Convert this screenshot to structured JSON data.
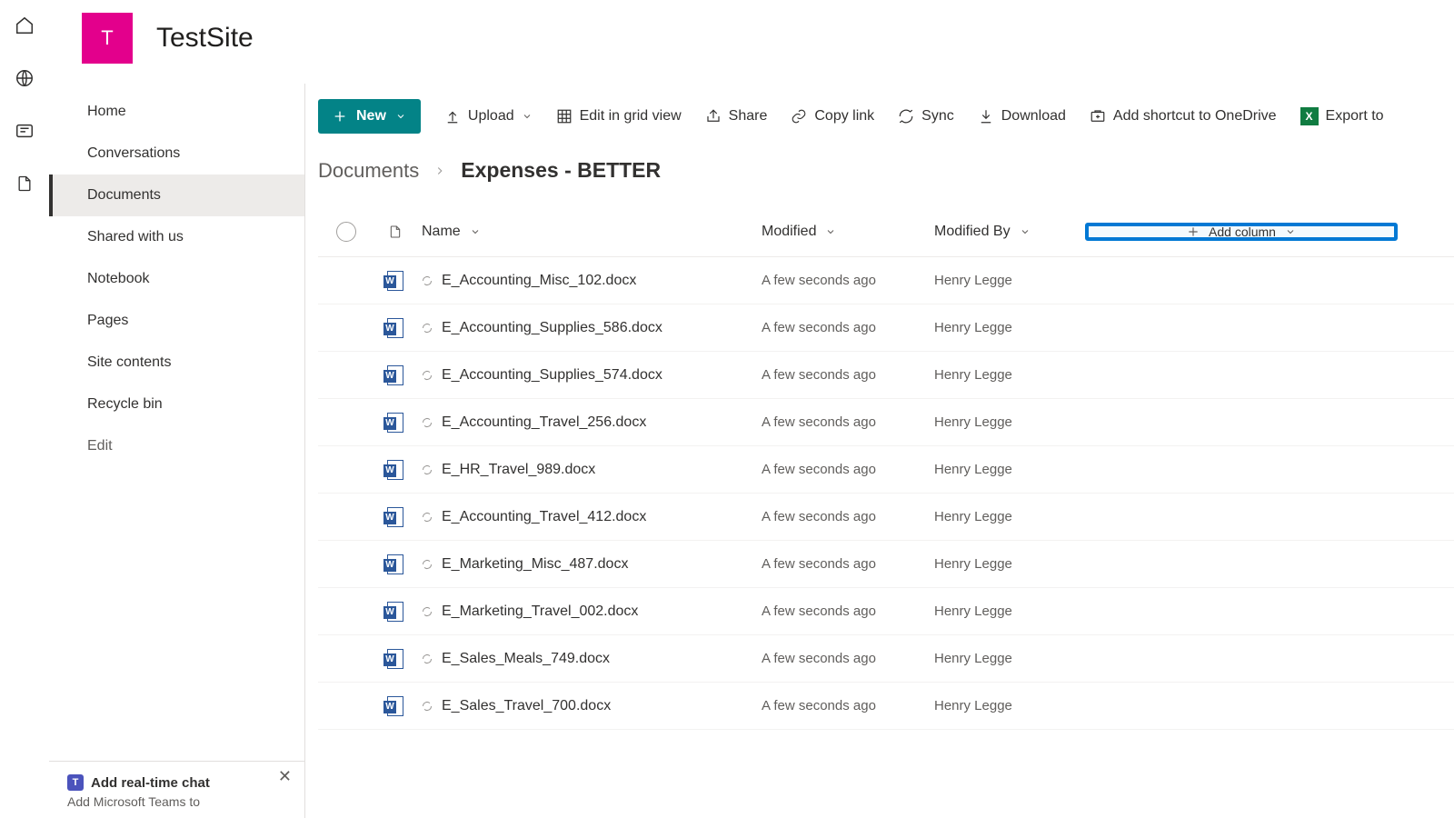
{
  "site": {
    "logo_letter": "T",
    "title": "TestSite"
  },
  "nav": {
    "items": [
      "Home",
      "Conversations",
      "Documents",
      "Shared with us",
      "Notebook",
      "Pages",
      "Site contents",
      "Recycle bin"
    ],
    "edit": "Edit",
    "active_index": 2
  },
  "teams_card": {
    "title": "Add real-time chat",
    "desc": "Add Microsoft Teams to"
  },
  "cmdbar": {
    "new": "New",
    "upload": "Upload",
    "edit_grid": "Edit in grid view",
    "share": "Share",
    "copy_link": "Copy link",
    "sync": "Sync",
    "download": "Download",
    "shortcut": "Add shortcut to OneDrive",
    "export": "Export to"
  },
  "breadcrumb": {
    "root": "Documents",
    "leaf": "Expenses - BETTER"
  },
  "columns": {
    "name": "Name",
    "modified": "Modified",
    "modified_by": "Modified By",
    "add_column": "Add column"
  },
  "files": [
    {
      "name": "E_Accounting_Misc_102.docx",
      "modified": "A few seconds ago",
      "modified_by": "Henry Legge"
    },
    {
      "name": "E_Accounting_Supplies_586.docx",
      "modified": "A few seconds ago",
      "modified_by": "Henry Legge"
    },
    {
      "name": "E_Accounting_Supplies_574.docx",
      "modified": "A few seconds ago",
      "modified_by": "Henry Legge"
    },
    {
      "name": "E_Accounting_Travel_256.docx",
      "modified": "A few seconds ago",
      "modified_by": "Henry Legge"
    },
    {
      "name": "E_HR_Travel_989.docx",
      "modified": "A few seconds ago",
      "modified_by": "Henry Legge"
    },
    {
      "name": "E_Accounting_Travel_412.docx",
      "modified": "A few seconds ago",
      "modified_by": "Henry Legge"
    },
    {
      "name": "E_Marketing_Misc_487.docx",
      "modified": "A few seconds ago",
      "modified_by": "Henry Legge"
    },
    {
      "name": "E_Marketing_Travel_002.docx",
      "modified": "A few seconds ago",
      "modified_by": "Henry Legge"
    },
    {
      "name": "E_Sales_Meals_749.docx",
      "modified": "A few seconds ago",
      "modified_by": "Henry Legge"
    },
    {
      "name": "E_Sales_Travel_700.docx",
      "modified": "A few seconds ago",
      "modified_by": "Henry Legge"
    }
  ]
}
